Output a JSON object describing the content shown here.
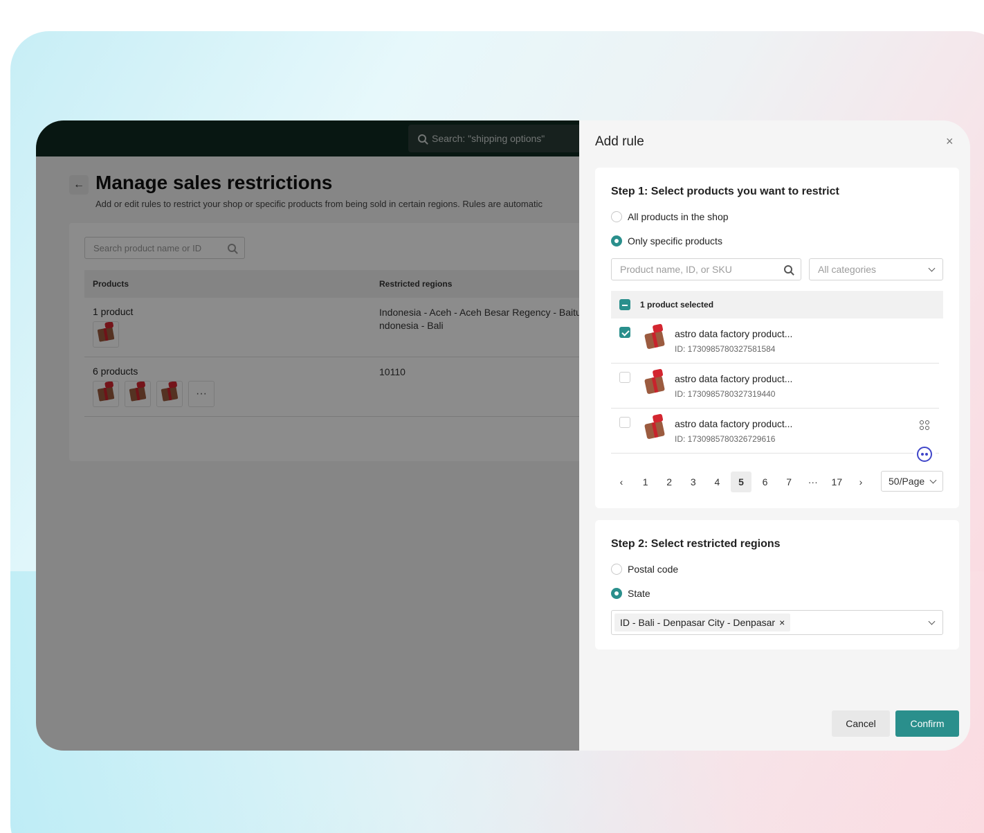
{
  "topbar": {
    "search_placeholder": "Search: \"shipping options\""
  },
  "page": {
    "back_icon": "←",
    "title": "Manage sales restrictions",
    "subtitle": "Add or edit rules to restrict your shop or specific products from being sold in certain regions. Rules are automatic"
  },
  "table": {
    "search_placeholder": "Search product name or ID",
    "headers": {
      "products": "Products",
      "regions": "Restricted regions"
    },
    "rows": [
      {
        "products": "1 product",
        "regions_line1": "Indonesia - Aceh - Aceh Besar Regency - Baitu",
        "regions_line2": "ndonesia - Bali"
      },
      {
        "products": "6 products",
        "regions_line1": "10110",
        "more": "···"
      }
    ]
  },
  "drawer": {
    "title": "Add rule",
    "close": "×",
    "step1": {
      "title": "Step 1: Select products you want to restrict",
      "option_all": "All products in the shop",
      "option_specific": "Only specific products",
      "search_placeholder": "Product name, ID, or SKU",
      "category_placeholder": "All categories",
      "selected_text": "1 product selected",
      "products": [
        {
          "name": "astro data factory product...",
          "id": "ID: 1730985780327581584",
          "checked": true
        },
        {
          "name": "astro data factory product...",
          "id": "ID: 1730985780327319440",
          "checked": false
        },
        {
          "name": "astro data factory product...",
          "id": "ID: 1730985780326729616",
          "checked": false
        }
      ],
      "pagination": {
        "prev": "‹",
        "next": "›",
        "pages": [
          "1",
          "2",
          "3",
          "4",
          "5",
          "6",
          "7",
          "···",
          "17"
        ],
        "active": "5",
        "page_size": "50/Page"
      }
    },
    "step2": {
      "title": "Step 2: Select restricted regions",
      "option_postal": "Postal code",
      "option_state": "State",
      "selected_tag": "ID - Bali - Denpasar City - Denpasar",
      "tag_remove": "×"
    },
    "cancel": "Cancel",
    "confirm": "Confirm"
  },
  "colors": {
    "accent": "#2a8f8c",
    "topbar": "#0f2a22",
    "overlay": "rgba(0,0,0,0.45)"
  },
  "icons": [
    "search-icon",
    "back-arrow-icon",
    "close-icon",
    "chevron-down-icon",
    "checkbox-icon",
    "grid-icon",
    "chat-bot-icon"
  ]
}
